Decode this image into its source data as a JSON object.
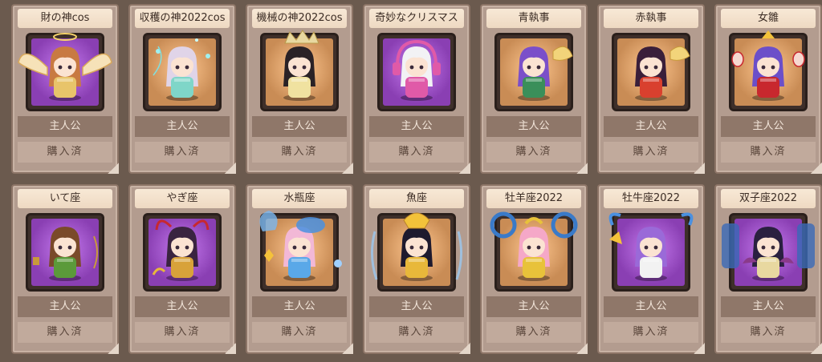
{
  "costumes": [
    {
      "name": "財の神cos",
      "role": "主人公",
      "status": "購入済",
      "bg": "#8a3fb3",
      "hair": "#c87a42",
      "outfit": "#e8c46a",
      "effect": "wings-icon"
    },
    {
      "name": "収穫の神2022cos",
      "role": "主人公",
      "status": "購入済",
      "bg": "#c98c55",
      "hair": "#e0d4e8",
      "outfit": "#7fd6c8",
      "effect": "sparkle-icon"
    },
    {
      "name": "機械の神2022cos",
      "role": "主人公",
      "status": "購入済",
      "bg": "#c98c55",
      "hair": "#2a2226",
      "outfit": "#f0e2a0",
      "effect": "crown-icon"
    },
    {
      "name": "奇妙なクリスマス",
      "role": "主人公",
      "status": "購入済",
      "bg": "#8a3fb3",
      "hair": "#f2f2f5",
      "outfit": "#e05aa8",
      "effect": "headphones-icon"
    },
    {
      "name": "青執事",
      "role": "主人公",
      "status": "購入済",
      "bg": "#c98c55",
      "hair": "#7b4fc9",
      "outfit": "#3a8f5a",
      "effect": "fan-icon"
    },
    {
      "name": "赤執事",
      "role": "主人公",
      "status": "購入済",
      "bg": "#c98c55",
      "hair": "#3a1f3a",
      "outfit": "#d9402e",
      "effect": "fan-icon"
    },
    {
      "name": "女雛",
      "role": "主人公",
      "status": "購入済",
      "bg": "#c98c55",
      "hair": "#6b4fc9",
      "outfit": "#c8282e",
      "effect": "lantern-icon"
    },
    {
      "name": "いて座",
      "role": "主人公",
      "status": "購入済",
      "bg": "#8a3fb3",
      "hair": "#7a4a2a",
      "outfit": "#5b9a3a",
      "effect": "bow-icon"
    },
    {
      "name": "やぎ座",
      "role": "主人公",
      "status": "購入済",
      "bg": "#8a3fb3",
      "hair": "#3a2440",
      "outfit": "#d8a23a",
      "effect": "horns-icon"
    },
    {
      "name": "水瓶座",
      "role": "主人公",
      "status": "購入済",
      "bg": "#c98c55",
      "hair": "#f2b8d6",
      "outfit": "#5aa8e8",
      "effect": "water-icon"
    },
    {
      "name": "魚座",
      "role": "主人公",
      "status": "購入済",
      "bg": "#c98c55",
      "hair": "#1e1a2e",
      "outfit": "#e8b83a",
      "effect": "fish-icon"
    },
    {
      "name": "牡羊座2022",
      "role": "主人公",
      "status": "購入済",
      "bg": "#c98c55",
      "hair": "#f5a8c8",
      "outfit": "#e8c23a",
      "effect": "ram-icon"
    },
    {
      "name": "牡牛座2022",
      "role": "主人公",
      "status": "購入済",
      "bg": "#8a3fb3",
      "hair": "#9a6ad8",
      "outfit": "#f2f2f2",
      "effect": "bull-icon"
    },
    {
      "name": "双子座2022",
      "role": "主人公",
      "status": "購入済",
      "bg": "#8a3fb3",
      "hair": "#2a2040",
      "outfit": "#e8d8a0",
      "effect": "twins-icon"
    }
  ]
}
